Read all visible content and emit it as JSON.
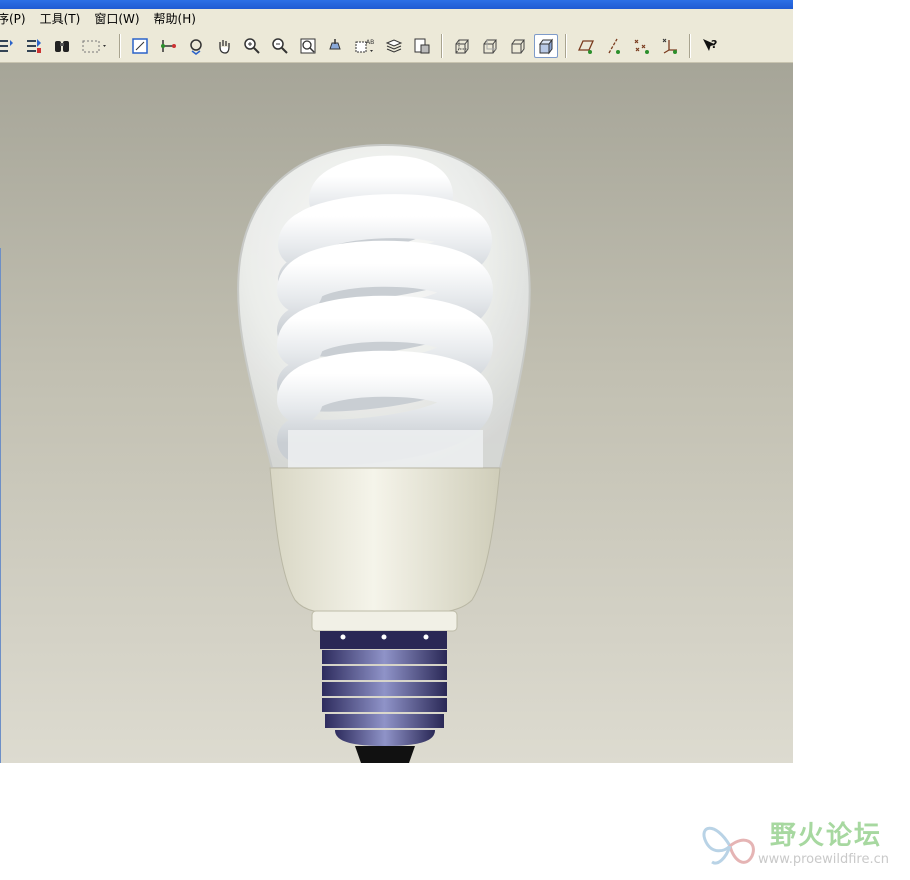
{
  "menu": {
    "items": [
      {
        "label": "序(P)"
      },
      {
        "label": "工具(T)"
      },
      {
        "label": "窗口(W)"
      },
      {
        "label": "帮助(H)"
      }
    ]
  },
  "toolbar": {
    "groups": [
      [
        "regen-icon",
        "regen-manager-icon",
        "find-icon",
        "select-box-icon"
      ],
      [
        "sketch-view-icon",
        "spin-center-icon",
        "orient-icon",
        "pan-icon",
        "zoom-in-icon",
        "zoom-out-icon",
        "refit-icon",
        "named-view-icon",
        "view-manager-icon",
        "layers-icon",
        "saved-views-icon"
      ],
      [
        "wireframe-icon",
        "hidden-line-icon",
        "no-hidden-icon",
        "shading-icon"
      ],
      [
        "datum-plane-icon",
        "datum-axis-icon",
        "datum-point-icon",
        "coord-sys-icon"
      ],
      [
        "context-help-icon"
      ]
    ],
    "active": "shading-icon"
  },
  "viewport": {
    "model": "compact-fluorescent-bulb"
  },
  "watermark": {
    "title": "野火论坛",
    "url": "www.proewildfire.cn"
  }
}
